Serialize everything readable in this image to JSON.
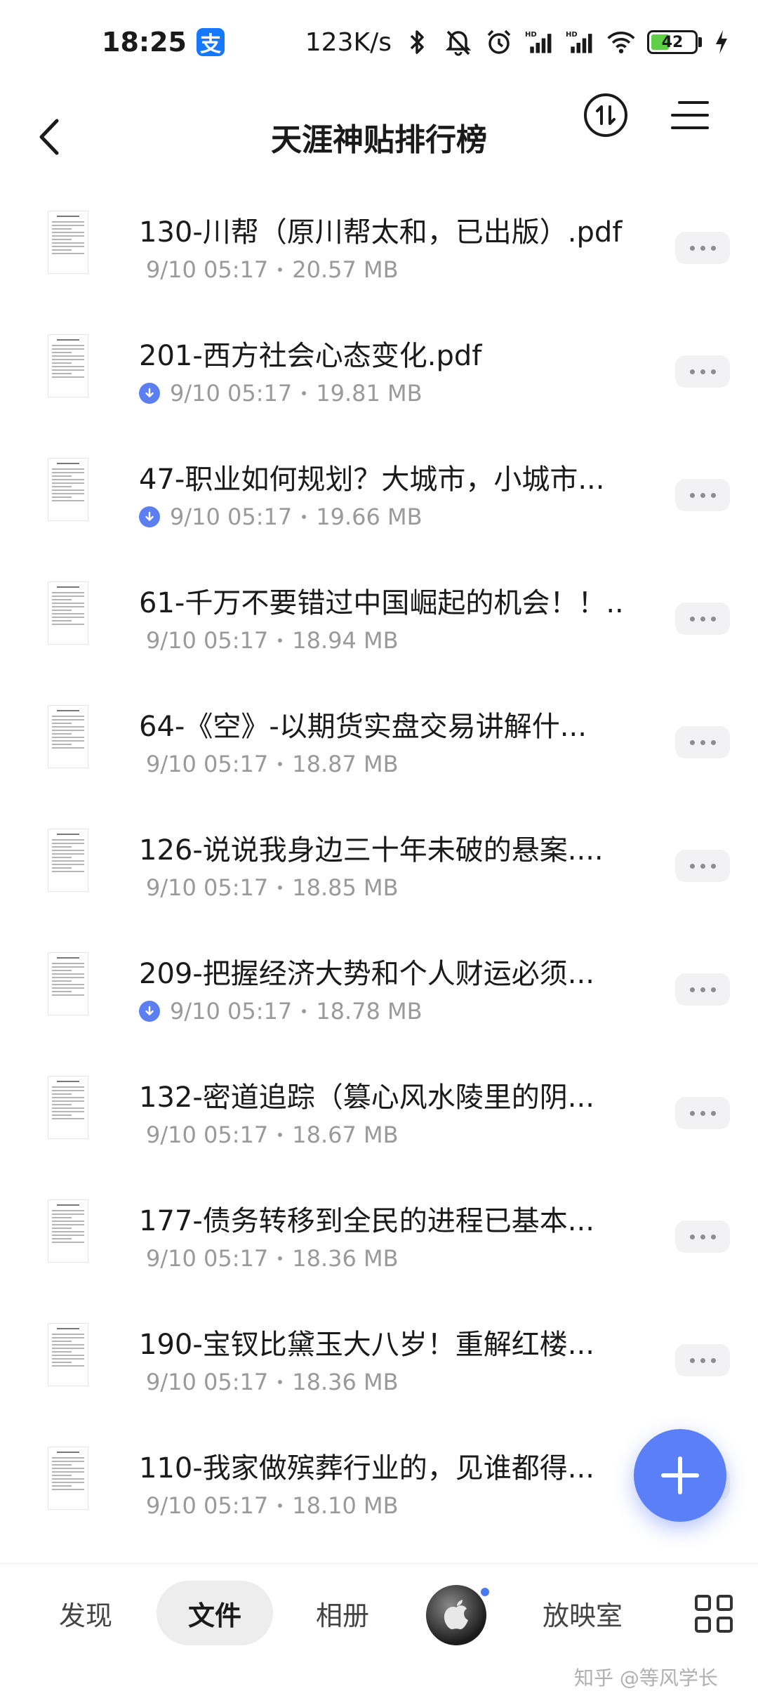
{
  "status_bar": {
    "time": "18:25",
    "alipay_label": "支",
    "net_speed": "123K/s",
    "battery_level": "42",
    "battery_fraction": 0.42
  },
  "header": {
    "title": "天涯神贴排行榜"
  },
  "files": [
    {
      "name": "130-川帮（原川帮太和，已出版）.pdf",
      "date": "9/10 05:17",
      "size": "20.57 MB",
      "downloaded": false
    },
    {
      "name": "201-西方社会心态变化.pdf",
      "date": "9/10 05:17",
      "size": "19.81 MB",
      "downloaded": true
    },
    {
      "name": "47-职业如何规划？大城市，小城市...",
      "date": "9/10 05:17",
      "size": "19.66 MB",
      "downloaded": true
    },
    {
      "name": "61-千万不要错过中国崛起的机会！！..",
      "date": "9/10 05:17",
      "size": "18.94 MB",
      "downloaded": false
    },
    {
      "name": "64-《空》-以期货实盘交易讲解什...",
      "date": "9/10 05:17",
      "size": "18.87 MB",
      "downloaded": false
    },
    {
      "name": "126-说说我身边三十年未破的悬案....",
      "date": "9/10 05:17",
      "size": "18.85 MB",
      "downloaded": false
    },
    {
      "name": "209-把握经济大势和个人财运必须...",
      "date": "9/10 05:17",
      "size": "18.78 MB",
      "downloaded": true
    },
    {
      "name": "132-密道追踪（篡心风水陵里的阴...",
      "date": "9/10 05:17",
      "size": "18.67 MB",
      "downloaded": false
    },
    {
      "name": "177-债务转移到全民的进程已基本...",
      "date": "9/10 05:17",
      "size": "18.36 MB",
      "downloaded": false
    },
    {
      "name": "190-宝钗比黛玉大八岁！重解红楼...",
      "date": "9/10 05:17",
      "size": "18.36 MB",
      "downloaded": false
    },
    {
      "name": "110-我家做殡葬行业的，见谁都得...",
      "date": "9/10 05:17",
      "size": "18.10 MB",
      "downloaded": false
    }
  ],
  "bottom_nav": {
    "discover": "发现",
    "files": "文件",
    "album": "相册",
    "theater": "放映室"
  },
  "watermark": "知乎 @等风学长",
  "colors": {
    "accent": "#5b7ff6",
    "download_badge": "#5b7ff0",
    "alipay": "#1677ff",
    "battery_fill": "#5fcf45"
  }
}
